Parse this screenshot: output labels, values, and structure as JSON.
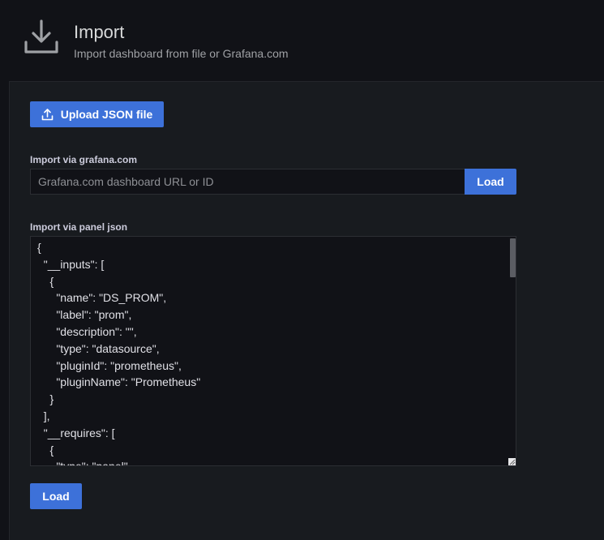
{
  "header": {
    "title": "Import",
    "subtitle": "Import dashboard from file or Grafana.com",
    "icon": "import-icon"
  },
  "upload": {
    "label": "Upload JSON file",
    "icon": "upload-icon"
  },
  "grafana_import": {
    "label": "Import via grafana.com",
    "placeholder": "Grafana.com dashboard URL or ID",
    "value": "",
    "load_label": "Load"
  },
  "json_import": {
    "label": "Import via panel json",
    "content": "{\n  \"__inputs\": [\n    {\n      \"name\": \"DS_PROM\",\n      \"label\": \"prom\",\n      \"description\": \"\",\n      \"type\": \"datasource\",\n      \"pluginId\": \"prometheus\",\n      \"pluginName\": \"Prometheus\"\n    }\n  ],\n  \"__requires\": [\n    {\n      \"type\": \"panel\","
  },
  "footer": {
    "load_label": "Load"
  },
  "colors": {
    "primary": "#3d71d9",
    "background": "#111217",
    "panel": "#181b1f"
  }
}
